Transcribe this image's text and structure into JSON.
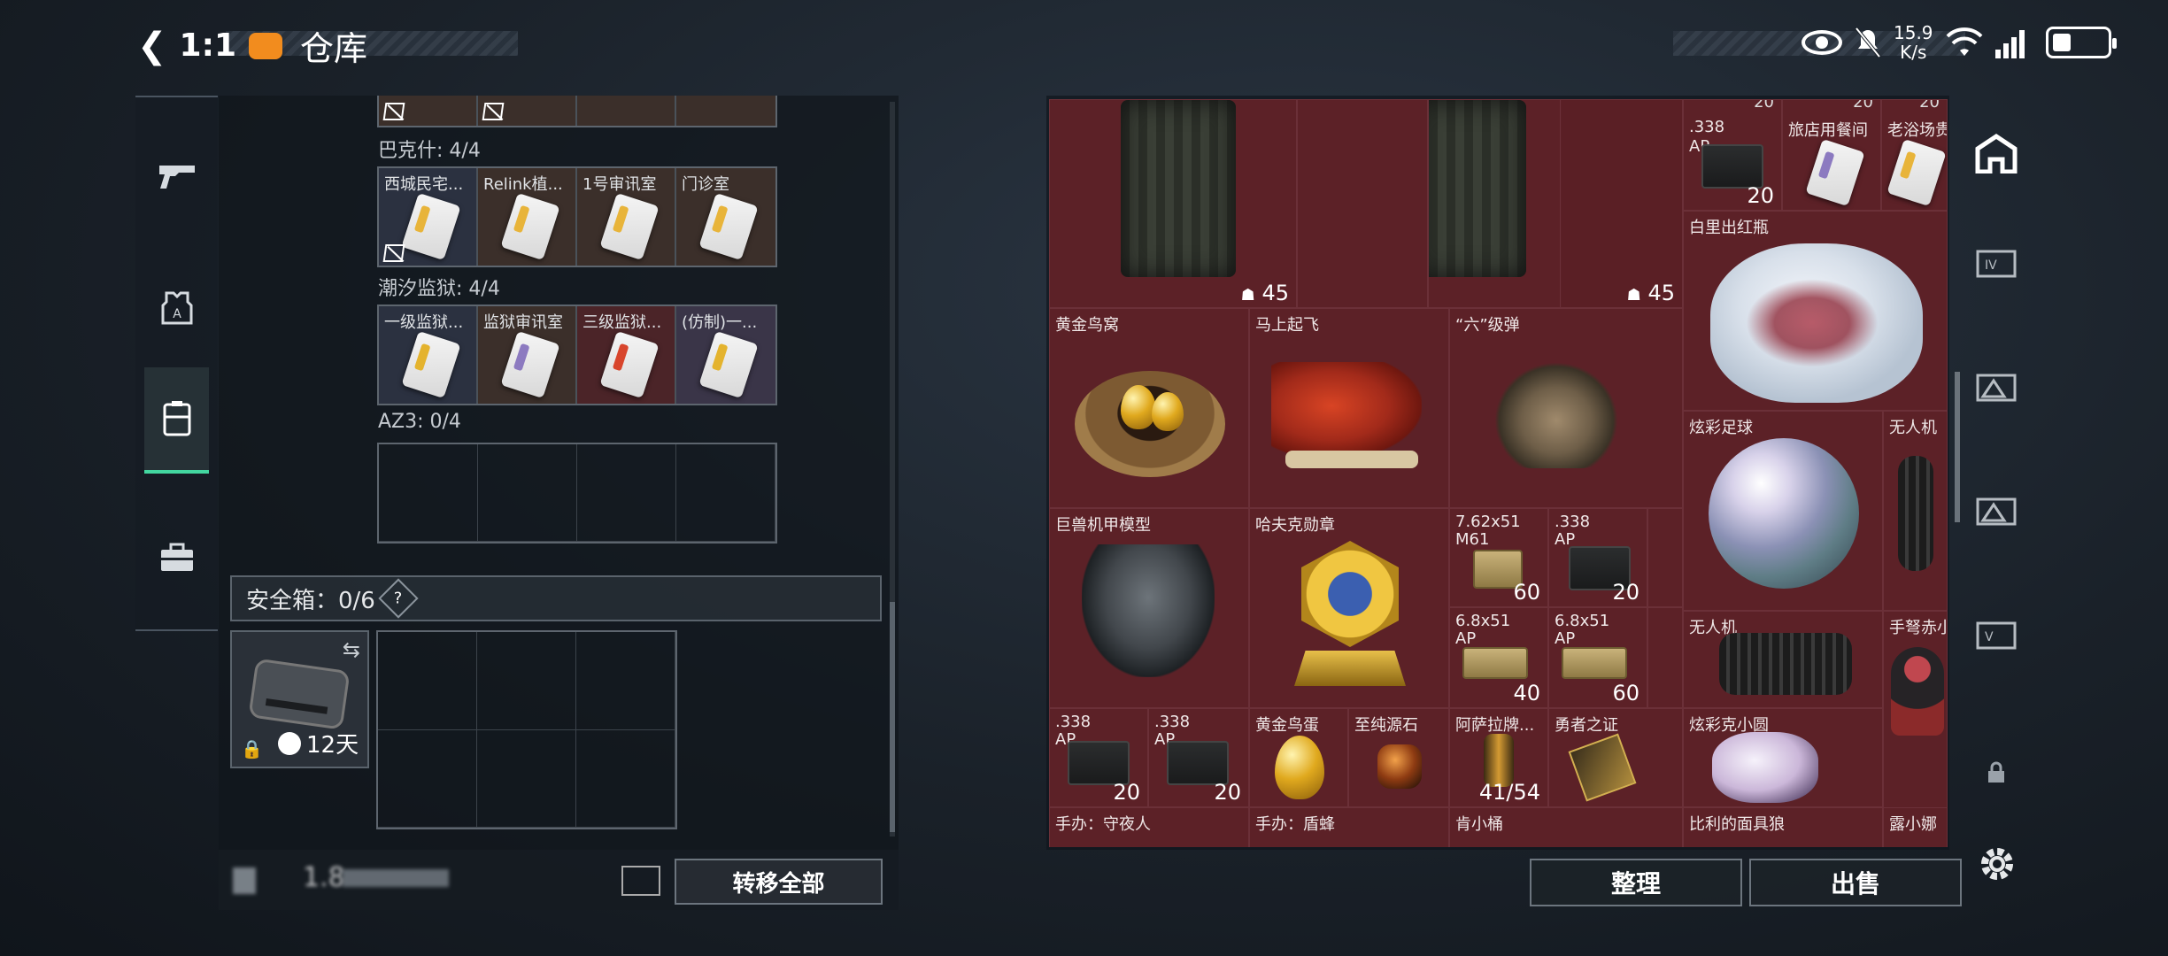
{
  "status_bar": {
    "time": "1:1",
    "title": "仓库",
    "speed": "15.9\nK/s",
    "battery": ""
  },
  "left_nav": {
    "items": [
      {
        "name": "weapon-tab"
      },
      {
        "name": "equipment-tab"
      },
      {
        "name": "storage-tab",
        "active": true
      },
      {
        "name": "toolbox-tab"
      }
    ]
  },
  "key_groups": [
    {
      "label": "巴克什: 4/4",
      "slots": [
        {
          "name": "西城民宅...",
          "bg": "white",
          "card": "gold",
          "nobag": true
        },
        {
          "name": "Relink植...",
          "bg": "brown",
          "card": "gold"
        },
        {
          "name": "1号审讯室",
          "bg": "brown",
          "card": "gold"
        },
        {
          "name": "门诊室",
          "bg": "brown",
          "card": "gold"
        }
      ]
    },
    {
      "label": "潮汐监狱: 4/4",
      "slots": [
        {
          "name": "一级监狱...",
          "bg": "white",
          "card": "yel"
        },
        {
          "name": "监狱审讯室",
          "bg": "brown",
          "card": "purple"
        },
        {
          "name": "三级监狱...",
          "bg": "red",
          "card": "red"
        },
        {
          "name": "(仿制)一...",
          "bg": "purple",
          "card": "yel"
        }
      ]
    },
    {
      "label": "AZ3: 0/4",
      "slots": []
    }
  ],
  "safe_box": {
    "label": "安全箱：0/6",
    "help": "?",
    "timer": "12天"
  },
  "bottom_left": {
    "capacity": "1.8",
    "transfer_all": "转移全部"
  },
  "items": [
    {
      "name": "",
      "count": "45",
      "icon": "ghost"
    },
    {
      "name": "",
      "count": "45",
      "icon": "ghost"
    },
    {
      "name": ".338",
      "sub": "AP",
      "count": "20"
    },
    {
      "name": "旅店用餐间",
      "count": ""
    },
    {
      "name": "老浴场贵...",
      "count": ""
    },
    {
      "name": "白里出红瓶",
      "count": ""
    },
    {
      "name": "黄金鸟窝",
      "count": ""
    },
    {
      "name": "马上起飞",
      "count": ""
    },
    {
      "name": "“六”级弹",
      "count": ""
    },
    {
      "name": "炫彩足球",
      "count": ""
    },
    {
      "name": "无人机",
      "count": ""
    },
    {
      "name": "巨兽机甲模型",
      "count": ""
    },
    {
      "name": "哈夫克勋章",
      "count": ""
    },
    {
      "name": "7.62x51",
      "sub": "M61",
      "count": "60"
    },
    {
      "name": ".338",
      "sub": "AP",
      "count": "20"
    },
    {
      "name": "6.8x51",
      "sub": "AP",
      "count": "40"
    },
    {
      "name": "6.8x51",
      "sub": "AP",
      "count": "60"
    },
    {
      "name": "无人机",
      "count": ""
    },
    {
      "name": "手弩赤小枭",
      "count": ""
    },
    {
      "name": ".338",
      "sub": "AP",
      "count": "20"
    },
    {
      "name": ".338",
      "sub": "AP",
      "count": "20"
    },
    {
      "name": "黄金鸟蛋",
      "count": ""
    },
    {
      "name": "至纯源石",
      "count": ""
    },
    {
      "name": "阿萨拉牌...",
      "count": "41/54"
    },
    {
      "name": "勇者之证",
      "count": ""
    },
    {
      "name": "炫彩克小圆",
      "count": ""
    },
    {
      "name": "手办：守夜人",
      "count": ""
    },
    {
      "name": "手办：盾蜂",
      "count": ""
    },
    {
      "name": "肯小桶",
      "count": ""
    },
    {
      "name": "比利的面具狼",
      "count": ""
    },
    {
      "name": "露小娜",
      "count": ""
    },
    {
      "name": "",
      "count": "20"
    },
    {
      "name": "",
      "count": "20"
    },
    {
      "name": "",
      "count": "20"
    }
  ],
  "right_nav": {
    "items": [
      "home-icon",
      "box-IV-icon",
      "box-III-icon",
      "box-II-icon",
      "box-V-icon",
      "lock-icon"
    ]
  },
  "actions": {
    "sort": "整理",
    "sell": "出售"
  }
}
